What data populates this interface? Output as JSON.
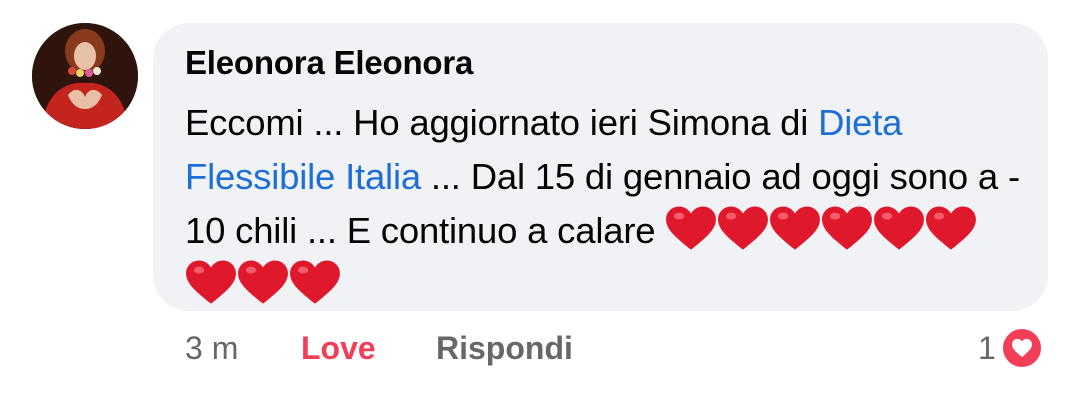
{
  "comment": {
    "author": "Eleonora Eleonora",
    "text_before_link": "Eccomi ... Ho aggiornato ieri Simona di ",
    "link_text": "Dieta Flessibile Italia",
    "text_after_link": " ... Dal 15 di gennaio ad oggi sono a - 10 chili ... E continuo a calare ",
    "heart_count": 9,
    "timestamp": "3 m",
    "reaction_label": "Love",
    "reply_label": "Rispondi",
    "reaction_count": "1",
    "reaction_icon": "heart-icon"
  },
  "colors": {
    "bubble": "#f0f2f5",
    "link": "#1d6fd6",
    "love": "#f33e58",
    "muted": "#65676b"
  }
}
